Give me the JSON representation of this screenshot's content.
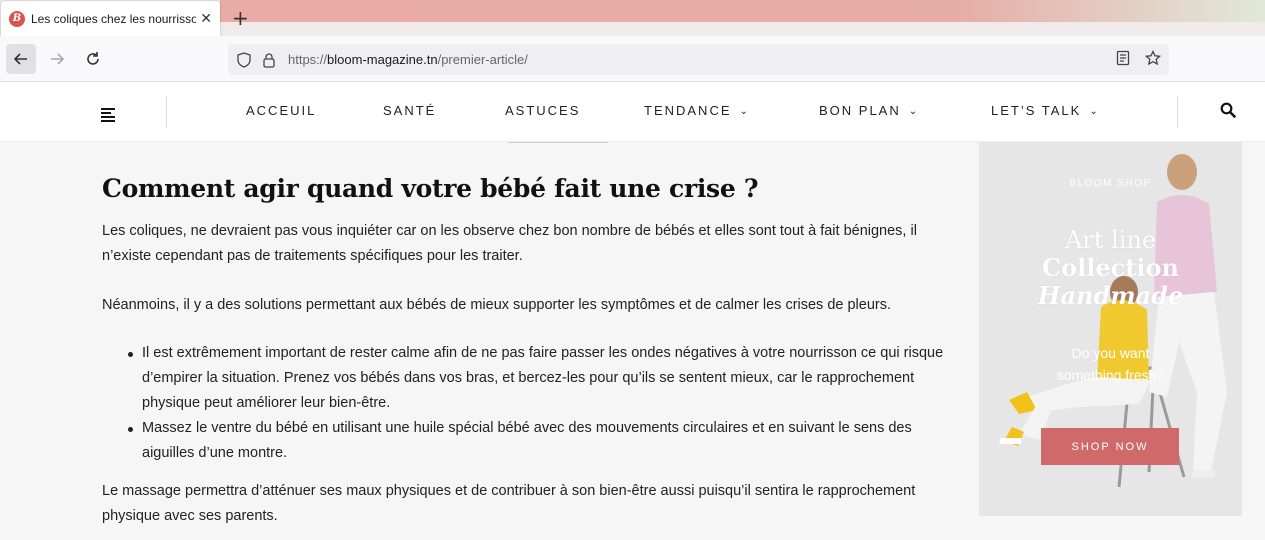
{
  "browser": {
    "tab_title": "Les coliques chez les nourrisson",
    "tab_favicon_letter": "B",
    "tab_close": "✕",
    "new_tab": "+",
    "url_protocol": "https://",
    "url_domain": "bloom-magazine.tn",
    "url_path": "/premier-article/"
  },
  "site": {
    "menu": [
      {
        "label": "ACCEUIL",
        "dropdown": false
      },
      {
        "label": "SANTÉ",
        "dropdown": false
      },
      {
        "label": "ASTUCES",
        "dropdown": false
      },
      {
        "label": "TENDANCE",
        "dropdown": true
      },
      {
        "label": "BON PLAN",
        "dropdown": true
      },
      {
        "label": "LET’S TALK",
        "dropdown": true
      }
    ],
    "chevron": "⌄"
  },
  "article": {
    "heading": "Comment agir quand votre bébé fait une crise ?",
    "p1_line1": "Les coliques, ne devraient pas vous inquiéter car on les observe chez bon nombre de bébés et elles sont tout à fait bénignes, il",
    "p1_line2": "n’existe cependant pas de traitements spécifiques pour les traiter.",
    "p2": "Néanmoins, il y a des solutions permettant aux bébés de mieux supporter les symptômes et de calmer les crises de pleurs.",
    "bullets": [
      "Il est extrêmement important de rester calme afin de ne pas faire passer les ondes négatives à votre nourrisson ce qui risque d’empirer la situation. Prenez vos bébés dans vos bras, et bercez-les pour qu’ils se sentent mieux, car le rapprochement physique peut améliorer leur bien-être.",
      "Massez le ventre du bébé en utilisant une huile spécial bébé avec des mouvements circulaires et en suivant le sens des aiguilles d’une montre."
    ],
    "p3_line1": "Le massage permettra d’atténuer ses maux physiques et de contribuer à son bien-être aussi puisqu’il sentira le rapprochement",
    "p3_line2": "physique avec ses parents."
  },
  "ad": {
    "shop_label": "BLOOM SHOP",
    "title_line1": "Art line",
    "title_line2": "Collection",
    "title_line3": "Handmade",
    "sub_line1": "Do you want",
    "sub_line2": "something fresh?",
    "button": "SHOP NOW"
  },
  "colors": {
    "accent": "#d06a6a",
    "favicon": "#d9534f"
  }
}
